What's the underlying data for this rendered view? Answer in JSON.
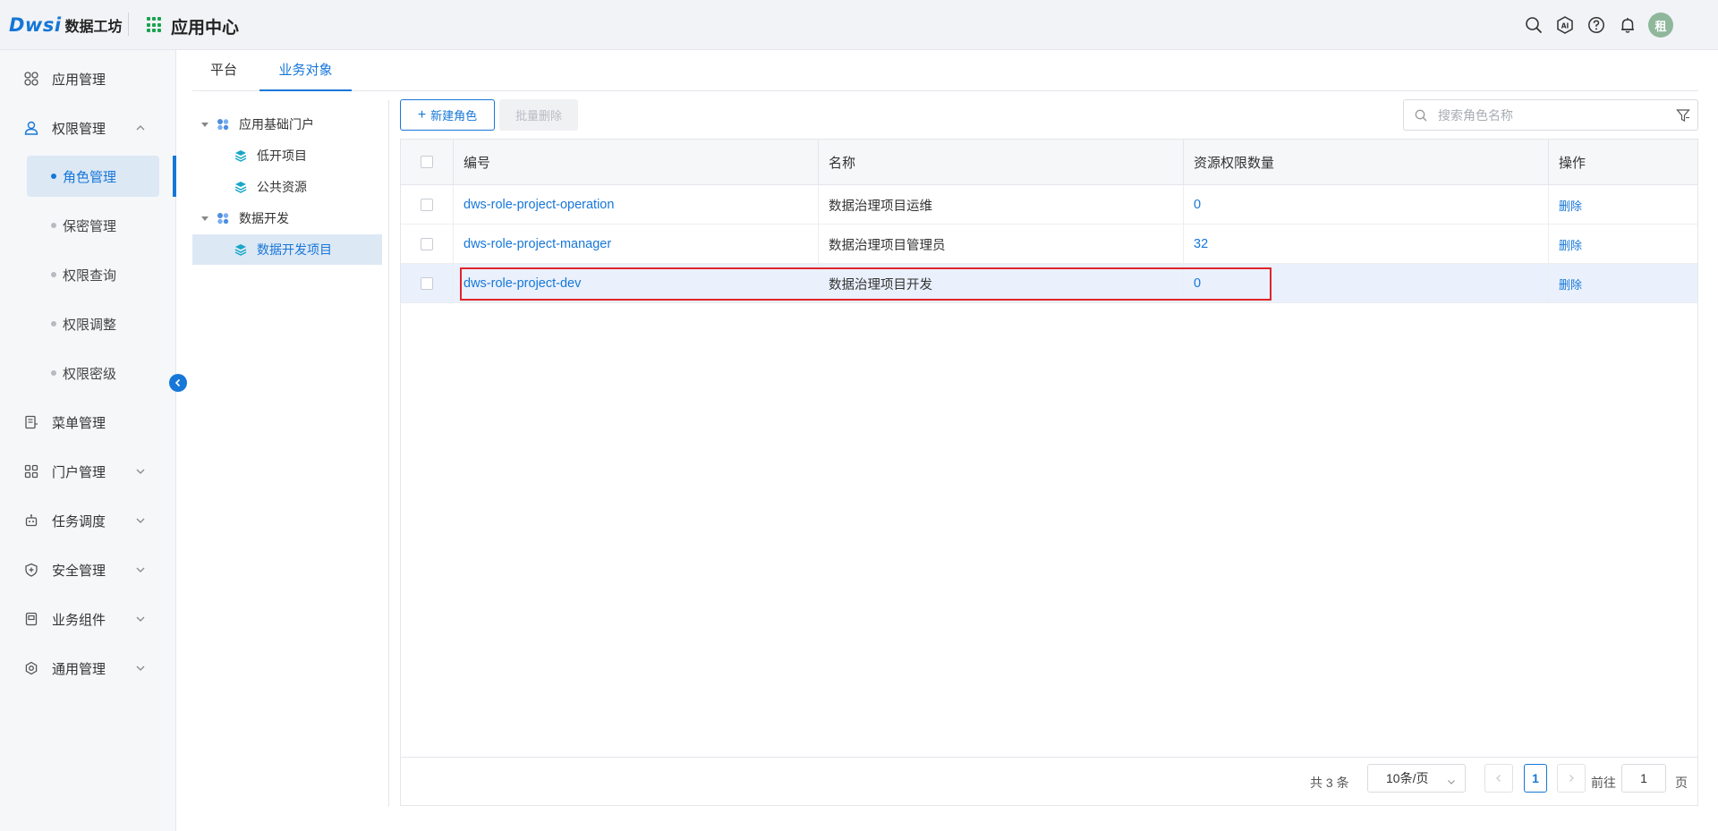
{
  "brand": {
    "logo": "Dwsi",
    "product": "数据工坊",
    "app_center": "应用中心"
  },
  "header_icons": [
    "search-icon",
    "ai-icon",
    "help-icon",
    "bell-icon"
  ],
  "user": {
    "avatar_text": "租"
  },
  "sidebar": {
    "items": [
      {
        "label": "应用管理",
        "icon": "apps-icon"
      },
      {
        "label": "权限管理",
        "icon": "user-lock-icon",
        "expanded": true
      },
      {
        "label": "菜单管理",
        "icon": "menu-doc-icon"
      },
      {
        "label": "门户管理",
        "icon": "portal-icon"
      },
      {
        "label": "任务调度",
        "icon": "robot-icon"
      },
      {
        "label": "安全管理",
        "icon": "shield-icon"
      },
      {
        "label": "业务组件",
        "icon": "component-icon"
      },
      {
        "label": "通用管理",
        "icon": "settings-icon"
      }
    ],
    "sub_items": [
      {
        "label": "角色管理",
        "active": true
      },
      {
        "label": "保密管理"
      },
      {
        "label": "权限查询"
      },
      {
        "label": "权限调整"
      },
      {
        "label": "权限密级"
      }
    ]
  },
  "tabs": [
    {
      "label": "平台"
    },
    {
      "label": "业务对象",
      "active": true
    }
  ],
  "tree": [
    {
      "label": "应用基础门户",
      "level": 0
    },
    {
      "label": "低开项目",
      "level": 1
    },
    {
      "label": "公共资源",
      "level": 1
    },
    {
      "label": "数据开发",
      "level": 0
    },
    {
      "label": "数据开发项目",
      "level": 1,
      "selected": true
    }
  ],
  "toolbar": {
    "new_role": "新建角色",
    "batch_delete": "批量删除",
    "search_placeholder": "搜索角色名称"
  },
  "table": {
    "columns": [
      "编号",
      "名称",
      "资源权限数量",
      "操作"
    ],
    "rows": [
      {
        "code": "dws-role-project-operation",
        "name": "数据治理项目运维",
        "count": "0",
        "action": "删除"
      },
      {
        "code": "dws-role-project-manager",
        "name": "数据治理项目管理员",
        "count": "32",
        "action": "删除"
      },
      {
        "code": "dws-role-project-dev",
        "name": "数据治理项目开发",
        "count": "0",
        "action": "删除",
        "highlighted": true
      }
    ]
  },
  "pagination": {
    "total": "共 3 条",
    "page_size": "10条/页",
    "current": "1",
    "goto_label": "前往",
    "goto_value": "1",
    "page_suffix": "页"
  },
  "colors": {
    "primary": "#1677d8",
    "highlight": "#e0242c"
  }
}
